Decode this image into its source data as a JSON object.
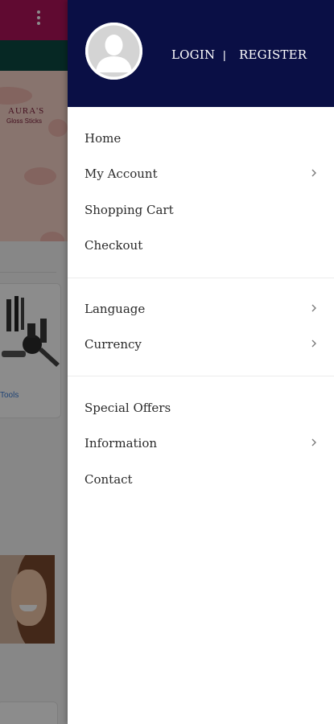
{
  "colors": {
    "drawer_header_bg": "#0a0f45",
    "app_header_bg": "#b0135a",
    "app_subbar_bg": "#0c4a43",
    "menu_text": "#2a2a2a",
    "chevron": "#7a7a7a"
  },
  "background_app": {
    "banner_title": "AURA'S",
    "banner_subtitle": "Gloss Sticks",
    "card_label": "Tools",
    "header_icon": "kebab-menu-icon"
  },
  "drawer": {
    "avatar_icon": "user-avatar-icon",
    "auth": {
      "login_label": "LOGIN",
      "separator": "|",
      "register_label": "REGISTER"
    },
    "groups": [
      {
        "items": [
          {
            "label": "Home",
            "has_arrow": false
          },
          {
            "label": "My Account",
            "has_arrow": true
          },
          {
            "label": "Shopping Cart",
            "has_arrow": false
          },
          {
            "label": "Checkout",
            "has_arrow": false
          }
        ]
      },
      {
        "items": [
          {
            "label": "Language",
            "has_arrow": true
          },
          {
            "label": "Currency",
            "has_arrow": true
          }
        ]
      },
      {
        "items": [
          {
            "label": "Special Offers",
            "has_arrow": false
          },
          {
            "label": "Information",
            "has_arrow": true
          },
          {
            "label": "Contact",
            "has_arrow": false
          }
        ]
      }
    ]
  }
}
